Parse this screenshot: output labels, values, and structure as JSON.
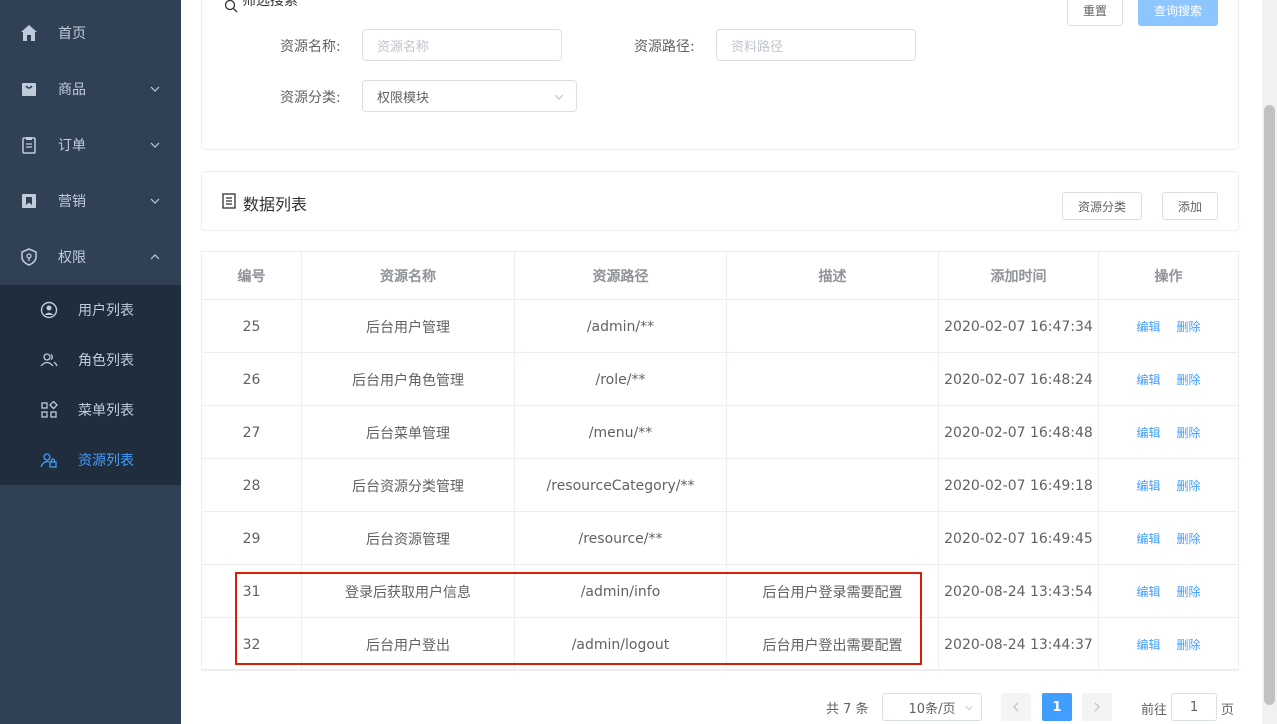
{
  "sidebar": {
    "items": [
      {
        "label": "首页",
        "icon": "home-icon"
      },
      {
        "label": "商品",
        "icon": "shopping-bag-icon"
      },
      {
        "label": "订单",
        "icon": "clipboard-icon"
      },
      {
        "label": "营销",
        "icon": "bookmark-icon"
      },
      {
        "label": "权限",
        "icon": "shield-icon"
      }
    ],
    "sub_items": [
      {
        "label": "用户列表",
        "icon": "user-circle-icon"
      },
      {
        "label": "角色列表",
        "icon": "users-icon"
      },
      {
        "label": "菜单列表",
        "icon": "grid-icon"
      },
      {
        "label": "资源列表",
        "icon": "user-lock-icon"
      }
    ]
  },
  "filter": {
    "title": "筛选搜索",
    "reset_label": "重置",
    "search_label": "查询搜索",
    "name_label": "资源名称:",
    "name_placeholder": "资源名称",
    "path_label": "资源路径:",
    "path_placeholder": "资料路径",
    "category_label": "资源分类:",
    "category_value": "权限模块"
  },
  "list": {
    "title": "数据列表",
    "category_button": "资源分类",
    "add_button": "添加"
  },
  "table": {
    "headers": [
      "编号",
      "资源名称",
      "资源路径",
      "描述",
      "添加时间",
      "操作"
    ],
    "edit_label": "编辑",
    "delete_label": "删除",
    "rows": [
      {
        "id": "25",
        "name": "后台用户管理",
        "path": "/admin/**",
        "desc": "",
        "time": "2020-02-07 16:47:34"
      },
      {
        "id": "26",
        "name": "后台用户角色管理",
        "path": "/role/**",
        "desc": "",
        "time": "2020-02-07 16:48:24"
      },
      {
        "id": "27",
        "name": "后台菜单管理",
        "path": "/menu/**",
        "desc": "",
        "time": "2020-02-07 16:48:48"
      },
      {
        "id": "28",
        "name": "后台资源分类管理",
        "path": "/resourceCategory/**",
        "desc": "",
        "time": "2020-02-07 16:49:18"
      },
      {
        "id": "29",
        "name": "后台资源管理",
        "path": "/resource/**",
        "desc": "",
        "time": "2020-02-07 16:49:45"
      },
      {
        "id": "31",
        "name": "登录后获取用户信息",
        "path": "/admin/info",
        "desc": "后台用户登录需要配置",
        "time": "2020-08-24 13:43:54"
      },
      {
        "id": "32",
        "name": "后台用户登出",
        "path": "/admin/logout",
        "desc": "后台用户登出需要配置",
        "time": "2020-08-24 13:44:37"
      }
    ]
  },
  "pagination": {
    "total": "共 7 条",
    "page_size": "10条/页",
    "current_page": "1",
    "goto_label": "前往",
    "goto_value": "1",
    "page_suffix": "页"
  },
  "colors": {
    "sidebar_bg": "#304156",
    "submenu_bg": "#1f2d3d",
    "accent": "#409eff",
    "highlight_border": "#d81e06"
  }
}
